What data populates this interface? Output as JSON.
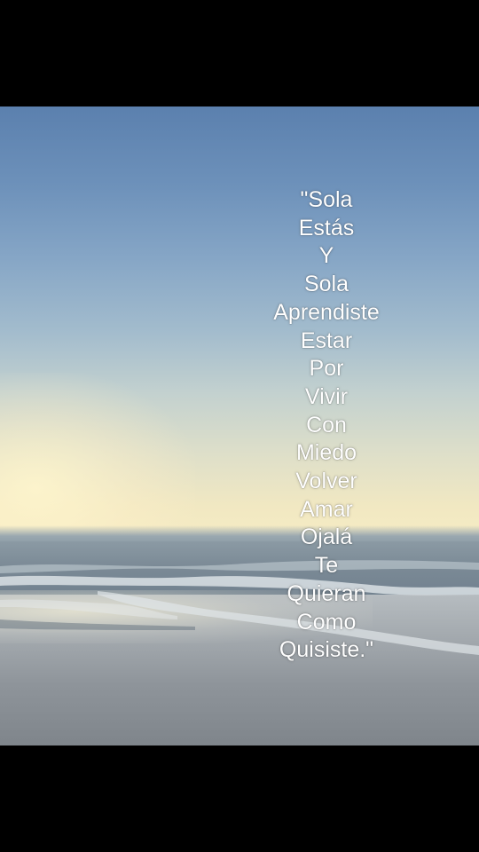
{
  "quote": {
    "lines": [
      "\"Sola",
      "Estás",
      "Y",
      "Sola",
      "Aprendiste",
      "Estar",
      "Por",
      "Vivir",
      "Con",
      "Miedo",
      "Volver",
      "Amar",
      "Ojalá",
      "Te",
      "Quieran",
      "Como",
      "Quisiste.\""
    ]
  },
  "colors": {
    "letterbox": "#000000",
    "sky_top": "#5b80ae",
    "horizon_glow": "#f6ecc4",
    "sea": "#7b8a96",
    "sand": "#a2a8ad",
    "text": "#ffffff"
  }
}
